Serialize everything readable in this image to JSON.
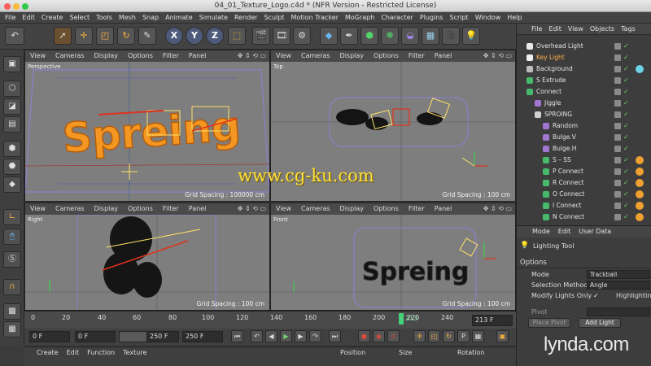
{
  "window": {
    "title": "04_01_Texture_Logo.c4d * (NFR Version - Restricted License)"
  },
  "menubar": [
    "File",
    "Edit",
    "Create",
    "Select",
    "Tools",
    "Mesh",
    "Snap",
    "Animate",
    "Simulate",
    "Render",
    "Sculpt",
    "Motion Tracker",
    "MoGraph",
    "Character",
    "Plugins",
    "Script",
    "Window",
    "Help"
  ],
  "toolbar": {
    "icons": [
      "undo-icon",
      "select-icon",
      "move-icon",
      "scale-icon",
      "rotate-icon",
      "recent-tool-icon",
      "x-axis",
      "y-axis",
      "z-axis",
      "coordinate-system-icon",
      "render-view-icon",
      "render-picture-queue-icon",
      "render-settings-icon",
      "cube-icon",
      "pen-spline-icon",
      "subdivision-icon",
      "mograph-cloner-icon",
      "deformer-icon",
      "floor-icon",
      "camera-icon",
      "light-icon"
    ],
    "axis_labels": [
      "X",
      "Y",
      "Z"
    ]
  },
  "viewport_menu": [
    "View",
    "Cameras",
    "Display",
    "Options",
    "Filter",
    "Panel"
  ],
  "viewports": [
    {
      "name": "Perspective",
      "grid": "Grid Spacing : 100000 cm",
      "logo_text": "Spreing"
    },
    {
      "name": "Top",
      "grid": "Grid Spacing : 100 cm"
    },
    {
      "name": "Right",
      "grid": "Grid Spacing : 100 cm"
    },
    {
      "name": "Front",
      "grid": "Grid Spacing : 100 cm",
      "logo_text": "Spreing"
    }
  ],
  "timeline": {
    "ticks": [
      "0",
      "20",
      "40",
      "60",
      "80",
      "100",
      "120",
      "140",
      "160",
      "180",
      "200",
      "220",
      "240"
    ],
    "current_frame": "213",
    "end_frame": "213 F"
  },
  "transport": {
    "start": "0 F",
    "range_start": "0 F",
    "range_end": "250 F",
    "end": "250 F"
  },
  "material_menu": [
    "Create",
    "Edit",
    "Function",
    "Texture"
  ],
  "coord_headers": [
    "Position",
    "Size",
    "Rotation"
  ],
  "objects_menu": [
    "File",
    "Edit",
    "View",
    "Objects",
    "Tags"
  ],
  "objects": [
    {
      "name": "Overhead Light",
      "indent": 0,
      "sel": false,
      "color": "#e8e8e8",
      "tag": ""
    },
    {
      "name": "Key Light",
      "indent": 0,
      "sel": true,
      "color": "#f0f0f0",
      "tag": ""
    },
    {
      "name": "Background",
      "indent": 0,
      "sel": false,
      "color": "#bcbcbc",
      "tag": "#6ad3e6"
    },
    {
      "name": "S Extrude",
      "indent": 0,
      "sel": false,
      "color": "#46b96d",
      "tag": ""
    },
    {
      "name": "Connect",
      "indent": 0,
      "sel": false,
      "color": "#46b96d",
      "tag": ""
    },
    {
      "name": "Jiggle",
      "indent": 1,
      "sel": false,
      "color": "#a276d1",
      "tag": ""
    },
    {
      "name": "SPROING",
      "indent": 1,
      "sel": false,
      "color": "#d0d0d0",
      "tag": ""
    },
    {
      "name": "Random",
      "indent": 2,
      "sel": false,
      "color": "#a276d1",
      "tag": ""
    },
    {
      "name": "Bulge.V",
      "indent": 2,
      "sel": false,
      "color": "#a276d1",
      "tag": ""
    },
    {
      "name": "Bulge.H",
      "indent": 2,
      "sel": false,
      "color": "#a276d1",
      "tag": ""
    },
    {
      "name": "S – SS",
      "indent": 2,
      "sel": false,
      "color": "#46b96d",
      "tag": "#f0a030"
    },
    {
      "name": "P Connect",
      "indent": 2,
      "sel": false,
      "color": "#46b96d",
      "tag": "#f0a030"
    },
    {
      "name": "R Connect",
      "indent": 2,
      "sel": false,
      "color": "#46b96d",
      "tag": "#f0a030"
    },
    {
      "name": "O Connect",
      "indent": 2,
      "sel": false,
      "color": "#46b96d",
      "tag": "#f0a030"
    },
    {
      "name": "I Connect",
      "indent": 2,
      "sel": false,
      "color": "#46b96d",
      "tag": "#f0a030"
    },
    {
      "name": "N Connect",
      "indent": 2,
      "sel": false,
      "color": "#46b96d",
      "tag": "#f0a030"
    }
  ],
  "attributes": {
    "menu": [
      "Mode",
      "Edit",
      "User Data"
    ],
    "tool_title": "Lighting Tool",
    "section": "Options",
    "mode_label": "Mode",
    "mode_value": "Trackball",
    "selection_label": "Selection Method",
    "selection_value": "Angle",
    "modify_label": "Modify Lights Only",
    "modify_value": "✓",
    "highlight_label": "Highlighting",
    "pivot_label": "Pivot",
    "place_pivot": "Place Pivot",
    "add_light": "Add Light"
  },
  "watermark": "www.cg-ku.com",
  "brand": "lynda.com",
  "colors": {
    "accent_orange": "#ffb14a",
    "logo_orange": "#f4941e",
    "playhead": "#45d07a"
  }
}
